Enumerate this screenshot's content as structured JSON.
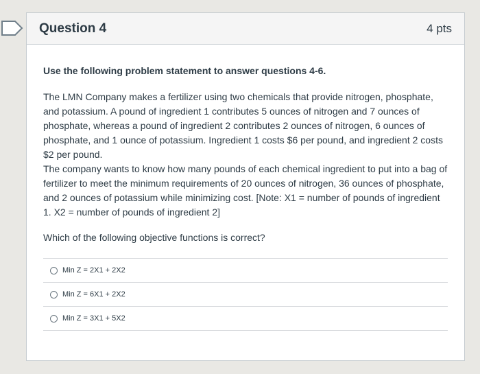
{
  "question": {
    "title": "Question 4",
    "points": "4 pts",
    "lead": "Use the following problem statement to answer questions 4-6.",
    "paragraph_1": "The LMN Company makes a fertilizer using two chemicals that provide nitrogen, phosphate, and potassium. A pound of ingredient 1 contributes 5 ounces of nitrogen and 7 ounces of phosphate, whereas a pound of ingredient 2 contributes 2 ounces of nitrogen, 6 ounces of phosphate, and 1 ounce of potassium. Ingredient 1 costs $6 per pound, and ingredient 2 costs $2 per pound.",
    "paragraph_2": "The company wants to know how many pounds of each chemical ingredient to put into a bag of fertilizer to meet the minimum requirements of 20 ounces of nitrogen, 36 ounces of phosphate, and 2 ounces of potassium while minimizing cost. [Note: X1 = number of pounds of ingredient 1. X2 = number of pounds of ingredient 2]",
    "prompt": "Which of the following objective functions is correct?"
  },
  "answers": [
    {
      "label": "Min Z = 2X1 + 2X2"
    },
    {
      "label": "Min Z = 6X1 + 2X2"
    },
    {
      "label": "Min Z = 3X1 + 5X2"
    }
  ],
  "colors": {
    "flag": "#6f7e89",
    "text": "#2d3b45",
    "border": "#c7cdd1"
  }
}
